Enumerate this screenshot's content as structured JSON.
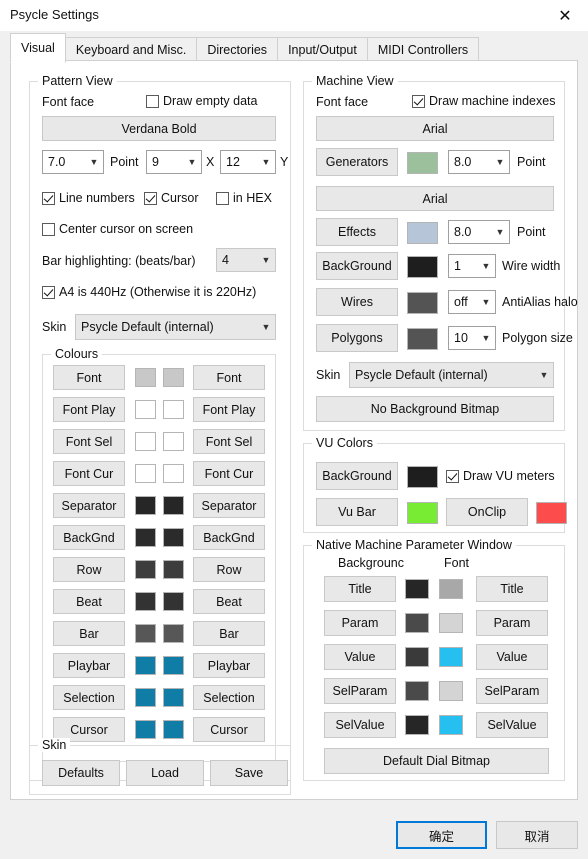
{
  "window": {
    "title": "Psycle Settings",
    "close_icon": "close-icon"
  },
  "tabs": [
    {
      "label": "Visual",
      "active": true
    },
    {
      "label": "Keyboard and Misc.",
      "active": false
    },
    {
      "label": "Directories",
      "active": false
    },
    {
      "label": "Input/Output",
      "active": false
    },
    {
      "label": "MIDI Controllers",
      "active": false
    }
  ],
  "pattern_view": {
    "title": "Pattern View",
    "font_face_label": "Font face",
    "draw_empty_data": {
      "label": "Draw empty data",
      "checked": false
    },
    "font_button": "Verdana Bold",
    "point_size": {
      "value": "7.0",
      "label": "Point"
    },
    "size_x": {
      "value": "9",
      "label": "X"
    },
    "size_y": {
      "value": "12",
      "label": "Y"
    },
    "line_numbers": {
      "label": "Line numbers",
      "checked": true
    },
    "cursor": {
      "label": "Cursor",
      "checked": true
    },
    "in_hex": {
      "label": "in HEX",
      "checked": false
    },
    "center_cursor": {
      "label": "Center cursor on screen",
      "checked": false
    },
    "bar_highlighting_label": "Bar highlighting: (beats/bar)",
    "bar_highlighting_value": "4",
    "a4_440": {
      "label": "A4 is 440Hz (Otherwise it is 220Hz)",
      "checked": true
    },
    "skin_label": "Skin",
    "skin_value": "Psycle Default (internal)",
    "colours": {
      "title": "Colours",
      "rows": [
        {
          "left": "Font",
          "right": "Font",
          "c1": "#c8c8c8",
          "c2": "#c8c8c8"
        },
        {
          "left": "Font Play",
          "right": "Font Play",
          "c1": "#ffffff",
          "c2": "#ffffff"
        },
        {
          "left": "Font Sel",
          "right": "Font Sel",
          "c1": "#ffffff",
          "c2": "#ffffff"
        },
        {
          "left": "Font Cur",
          "right": "Font Cur",
          "c1": "#ffffff",
          "c2": "#ffffff"
        },
        {
          "left": "Separator",
          "right": "Separator",
          "c1": "#262626",
          "c2": "#262626"
        },
        {
          "left": "BackGnd",
          "right": "BackGnd",
          "c1": "#2b2b2b",
          "c2": "#2b2b2b"
        },
        {
          "left": "Row",
          "right": "Row",
          "c1": "#3d3d3d",
          "c2": "#3d3d3d"
        },
        {
          "left": "Beat",
          "right": "Beat",
          "c1": "#333333",
          "c2": "#333333"
        },
        {
          "left": "Bar",
          "right": "Bar",
          "c1": "#575757",
          "c2": "#575757"
        },
        {
          "left": "Playbar",
          "right": "Playbar",
          "c1": "#0f7da5",
          "c2": "#0f7da5"
        },
        {
          "left": "Selection",
          "right": "Selection",
          "c1": "#0f7da5",
          "c2": "#0f7da5"
        },
        {
          "left": "Cursor",
          "right": "Cursor",
          "c1": "#0f7da5",
          "c2": "#0f7da5"
        }
      ]
    }
  },
  "skin_group": {
    "title": "Skin",
    "defaults": "Defaults",
    "load": "Load",
    "save": "Save"
  },
  "machine_view": {
    "title": "Machine View",
    "font_face_label": "Font face",
    "draw_machine_indexes": {
      "label": "Draw machine indexes",
      "checked": true
    },
    "font1_button": "Arial",
    "generators": {
      "label": "Generators",
      "color": "#9cbf9c",
      "point": "8.0",
      "point_label": "Point"
    },
    "font2_button": "Arial",
    "effects": {
      "label": "Effects",
      "color": "#b6c6d8",
      "point": "8.0",
      "point_label": "Point"
    },
    "background": {
      "label": "BackGround",
      "color": "#1e1e1e",
      "value": "1",
      "value_label": "Wire width"
    },
    "wires": {
      "label": "Wires",
      "color": "#545454",
      "value": "off",
      "value_label": "AntiAlias halo"
    },
    "polygons": {
      "label": "Polygons",
      "color": "#545454",
      "value": "10",
      "value_label": "Polygon size"
    },
    "skin_label": "Skin",
    "skin_value": "Psycle Default (internal)",
    "no_bg_bitmap": "No Background Bitmap"
  },
  "vu_colors": {
    "title": "VU Colors",
    "background": {
      "label": "BackGround",
      "color": "#1e1e1e"
    },
    "draw_vu_meters": {
      "label": "Draw VU meters",
      "checked": true
    },
    "vu_bar": {
      "label": "Vu Bar",
      "color": "#77ec33"
    },
    "onclip": {
      "label": "OnClip",
      "color": "#fc4c4c"
    }
  },
  "native_param_window": {
    "title": "Native Machine Parameter Window",
    "header_background": "Backgrounc",
    "header_font": "Font",
    "rows": [
      {
        "left": "Title",
        "right": "Title",
        "bg": "#262626",
        "fg": "#a8a8a8"
      },
      {
        "left": "Param",
        "right": "Param",
        "bg": "#4a4a4a",
        "fg": "#d4d4d4"
      },
      {
        "left": "Value",
        "right": "Value",
        "bg": "#3a3a3a",
        "fg": "#25c0ef"
      },
      {
        "left": "SelParam",
        "right": "SelParam",
        "bg": "#4a4a4a",
        "fg": "#d4d4d4"
      },
      {
        "left": "SelValue",
        "right": "SelValue",
        "bg": "#262626",
        "fg": "#25c0ef"
      }
    ],
    "default_dial_bitmap": "Default Dial Bitmap"
  },
  "dialog_buttons": {
    "ok": "确定",
    "cancel": "取消"
  }
}
